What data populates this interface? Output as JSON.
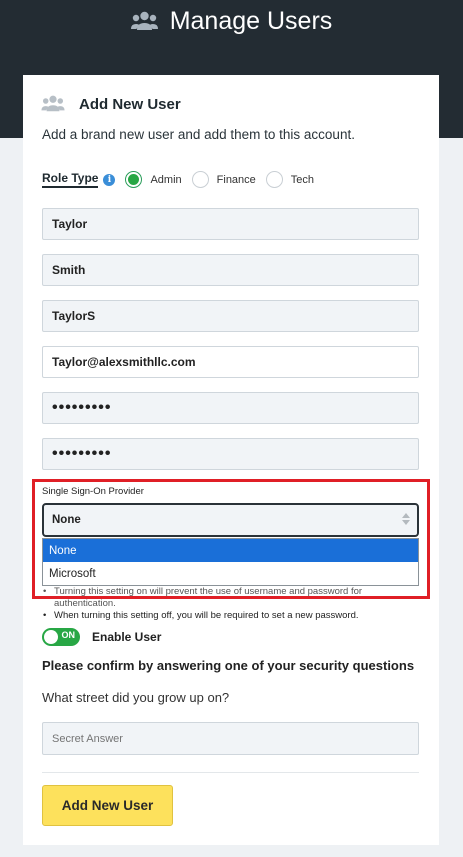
{
  "header": {
    "title": "Manage Users",
    "icon": "users-icon"
  },
  "card": {
    "title": "Add New User",
    "icon": "users-icon",
    "subtitle": "Add a brand new user and add them to this account."
  },
  "role": {
    "label": "Role Type",
    "info_icon": "i",
    "options": [
      {
        "label": "Admin",
        "selected": true
      },
      {
        "label": "Finance",
        "selected": false
      },
      {
        "label": "Tech",
        "selected": false
      }
    ]
  },
  "fields": {
    "first_name": "Taylor",
    "last_name": "Smith",
    "username": "TaylorS",
    "email": "Taylor@alexsmithllc.com",
    "password": "•••••••••",
    "confirm_password": "•••••••••"
  },
  "sso": {
    "label": "Single Sign-On Provider",
    "selected": "None",
    "options": [
      "None",
      "Microsoft"
    ]
  },
  "notes": [
    "Turning this setting on will prevent the use of username and password for authentication.",
    "When turning this setting off, you will be required to set a new password."
  ],
  "enable_user": {
    "toggle_text": "ON",
    "label": "Enable User"
  },
  "security": {
    "heading": "Please confirm by answering one of your security questions",
    "question": "What street did you grow up on?",
    "answer_placeholder": "Secret Answer"
  },
  "submit_label": "Add New User",
  "colors": {
    "header_bg": "#232c33",
    "accent_green": "#28a745",
    "highlight_red": "#e01f26",
    "button_yellow": "#fde15c",
    "option_blue": "#1a6fd8"
  }
}
